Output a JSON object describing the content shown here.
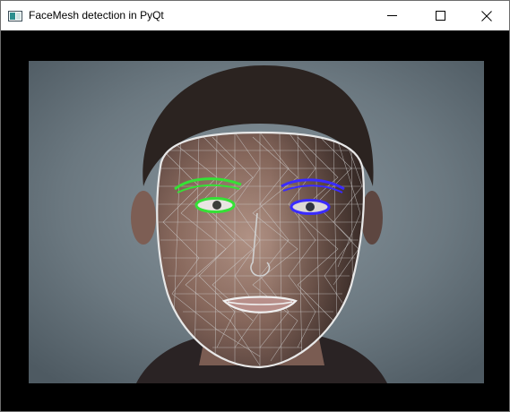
{
  "window": {
    "title": "FaceMesh detection in PyQt",
    "icon": "pyqt-window-icon"
  },
  "controls": {
    "minimize": "minimize-icon",
    "maximize": "maximize-icon",
    "close": "close-icon"
  },
  "video_feed": {
    "description_icon": "camera-frame",
    "colors": {
      "background": "#6f7d86",
      "left_eye_overlay": "#2fe02f",
      "right_eye_overlay": "#3a2bff",
      "face_outline": "#e6e6e6",
      "mesh": "#c9c9c9"
    }
  }
}
